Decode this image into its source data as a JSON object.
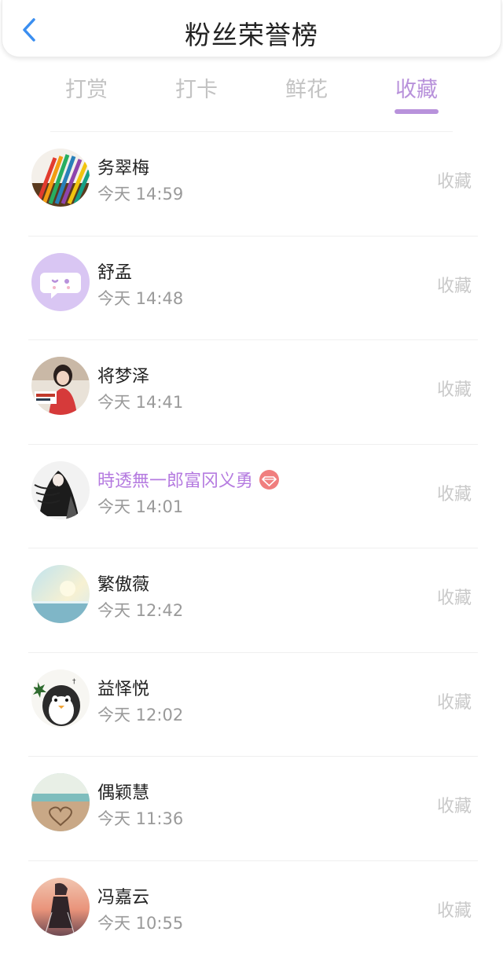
{
  "header": {
    "title": "粉丝荣誉榜",
    "back_icon": "chevron-left-icon",
    "accent": "#3a8ef0"
  },
  "tabs": [
    {
      "label": "打赏",
      "active": false
    },
    {
      "label": "打卡",
      "active": false
    },
    {
      "label": "鲜花",
      "active": false
    },
    {
      "label": "收藏",
      "active": true
    }
  ],
  "colors": {
    "active_tab": "#b892db",
    "vip_name": "#b57be0",
    "badge": "#f07e7e"
  },
  "fans": [
    {
      "name": "务翠梅",
      "time": "今天 14:59",
      "action": "收藏",
      "avatar": "colored-pencils"
    },
    {
      "name": "舒孟",
      "time": "今天 14:48",
      "action": "收藏",
      "avatar": "chat-bubble-default"
    },
    {
      "name": "将梦泽",
      "time": "今天 14:41",
      "action": "收藏",
      "avatar": "girl-photo"
    },
    {
      "name": "時透無一郎富冈义勇",
      "time": "今天 14:01",
      "action": "收藏",
      "avatar": "anime-character",
      "vip": true,
      "badge_icon": "diamond-icon"
    },
    {
      "name": "繁傲薇",
      "time": "今天 12:42",
      "action": "收藏",
      "avatar": "sea-sky"
    },
    {
      "name": "益怿悦",
      "time": "今天 12:02",
      "action": "收藏",
      "avatar": "penguin-sticker"
    },
    {
      "name": "偶颖慧",
      "time": "今天 11:36",
      "action": "收藏",
      "avatar": "beach-heart"
    },
    {
      "name": "冯嘉云",
      "time": "今天 10:55",
      "action": "收藏",
      "avatar": "sunset-figure"
    }
  ]
}
